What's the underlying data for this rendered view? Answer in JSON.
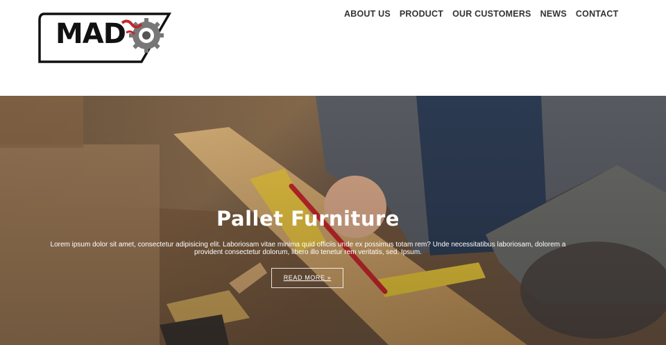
{
  "logo": {
    "text": "MAD"
  },
  "nav": {
    "items": [
      {
        "label": "ABOUT US"
      },
      {
        "label": "PRODUCT"
      },
      {
        "label": "OUR CUSTOMERS"
      },
      {
        "label": "NEWS"
      },
      {
        "label": "CONTACT"
      }
    ]
  },
  "hero": {
    "title": "Pallet Furniture",
    "text": "Lorem ipsum dolor sit amet, consectetur adipisicing elit. Laboriosam vitae minima quid officiis unde ex possimus totam rem? Unde necessitatibus laboriosam, dolorem a provident consectetur dolorum, libero illo tenetur rem veritatis, sed. Ipsum.",
    "button_label": "READ MORE »"
  },
  "colors": {
    "nav_text": "#333333",
    "hero_text": "#ffffff",
    "logo_border": "#111111",
    "logo_accent": "#c0282d"
  }
}
